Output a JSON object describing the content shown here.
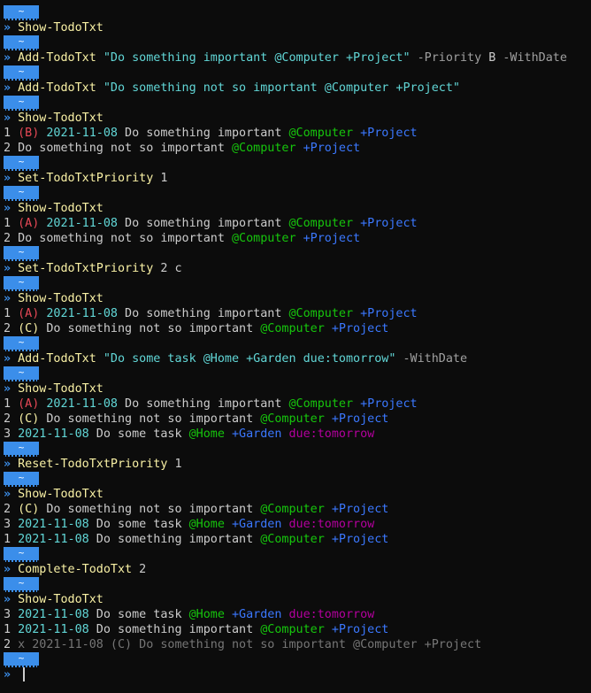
{
  "terminal": {
    "prompt_badge": "~",
    "prompt_arrow": "»",
    "lines": [
      {
        "type": "badge"
      },
      {
        "type": "cmd",
        "segments": [
          {
            "text": "Show-TodoTxt",
            "color": "#f9f1a5"
          }
        ]
      },
      {
        "type": "badge"
      },
      {
        "type": "cmd",
        "segments": [
          {
            "text": "Add-TodoTxt",
            "color": "#f9f1a5"
          },
          {
            "text": " \"Do something important @Computer +Project\"",
            "color": "#61d6d6"
          },
          {
            "text": " -Priority",
            "color": "#a0a0a0"
          },
          {
            "text": " B",
            "color": "#cccccc"
          },
          {
            "text": " -WithDate",
            "color": "#a0a0a0"
          }
        ]
      },
      {
        "type": "badge"
      },
      {
        "type": "cmd",
        "segments": [
          {
            "text": "Add-TodoTxt",
            "color": "#f9f1a5"
          },
          {
            "text": " \"Do something not so important @Computer +Project\"",
            "color": "#61d6d6"
          }
        ]
      },
      {
        "type": "badge"
      },
      {
        "type": "cmd",
        "segments": [
          {
            "text": "Show-TodoTxt",
            "color": "#f9f1a5"
          }
        ]
      },
      {
        "type": "out",
        "segments": [
          {
            "text": "1 ",
            "color": "#cccccc"
          },
          {
            "text": "(B)",
            "color": "#e74856"
          },
          {
            "text": " ",
            "color": "#cccccc"
          },
          {
            "text": "2021-11-08",
            "color": "#61d6d6"
          },
          {
            "text": " Do something important ",
            "color": "#cccccc"
          },
          {
            "text": "@Computer",
            "color": "#16c60c"
          },
          {
            "text": " ",
            "color": "#cccccc"
          },
          {
            "text": "+Project",
            "color": "#3b78ff"
          }
        ]
      },
      {
        "type": "out",
        "segments": [
          {
            "text": "2 Do something not so important ",
            "color": "#cccccc"
          },
          {
            "text": "@Computer",
            "color": "#16c60c"
          },
          {
            "text": " ",
            "color": "#cccccc"
          },
          {
            "text": "+Project",
            "color": "#3b78ff"
          }
        ]
      },
      {
        "type": "badge"
      },
      {
        "type": "cmd",
        "segments": [
          {
            "text": "Set-TodoTxtPriority",
            "color": "#f9f1a5"
          },
          {
            "text": " 1",
            "color": "#cccccc"
          }
        ]
      },
      {
        "type": "badge"
      },
      {
        "type": "cmd",
        "segments": [
          {
            "text": "Show-TodoTxt",
            "color": "#f9f1a5"
          }
        ]
      },
      {
        "type": "out",
        "segments": [
          {
            "text": "1 ",
            "color": "#cccccc"
          },
          {
            "text": "(A)",
            "color": "#e74856"
          },
          {
            "text": " ",
            "color": "#cccccc"
          },
          {
            "text": "2021-11-08",
            "color": "#61d6d6"
          },
          {
            "text": " Do something important ",
            "color": "#cccccc"
          },
          {
            "text": "@Computer",
            "color": "#16c60c"
          },
          {
            "text": " ",
            "color": "#cccccc"
          },
          {
            "text": "+Project",
            "color": "#3b78ff"
          }
        ]
      },
      {
        "type": "out",
        "segments": [
          {
            "text": "2 Do something not so important ",
            "color": "#cccccc"
          },
          {
            "text": "@Computer",
            "color": "#16c60c"
          },
          {
            "text": " ",
            "color": "#cccccc"
          },
          {
            "text": "+Project",
            "color": "#3b78ff"
          }
        ]
      },
      {
        "type": "badge"
      },
      {
        "type": "cmd",
        "segments": [
          {
            "text": "Set-TodoTxtPriority",
            "color": "#f9f1a5"
          },
          {
            "text": " 2 c",
            "color": "#cccccc"
          }
        ]
      },
      {
        "type": "badge"
      },
      {
        "type": "cmd",
        "segments": [
          {
            "text": "Show-TodoTxt",
            "color": "#f9f1a5"
          }
        ]
      },
      {
        "type": "out",
        "segments": [
          {
            "text": "1 ",
            "color": "#cccccc"
          },
          {
            "text": "(A)",
            "color": "#e74856"
          },
          {
            "text": " ",
            "color": "#cccccc"
          },
          {
            "text": "2021-11-08",
            "color": "#61d6d6"
          },
          {
            "text": " Do something important ",
            "color": "#cccccc"
          },
          {
            "text": "@Computer",
            "color": "#16c60c"
          },
          {
            "text": " ",
            "color": "#cccccc"
          },
          {
            "text": "+Project",
            "color": "#3b78ff"
          }
        ]
      },
      {
        "type": "out",
        "segments": [
          {
            "text": "2 ",
            "color": "#cccccc"
          },
          {
            "text": "(C)",
            "color": "#f9f1a5"
          },
          {
            "text": " Do something not so important ",
            "color": "#cccccc"
          },
          {
            "text": "@Computer",
            "color": "#16c60c"
          },
          {
            "text": " ",
            "color": "#cccccc"
          },
          {
            "text": "+Project",
            "color": "#3b78ff"
          }
        ]
      },
      {
        "type": "badge"
      },
      {
        "type": "cmd",
        "segments": [
          {
            "text": "Add-TodoTxt",
            "color": "#f9f1a5"
          },
          {
            "text": " \"Do some task @Home +Garden due:tomorrow\"",
            "color": "#61d6d6"
          },
          {
            "text": " -WithDate",
            "color": "#a0a0a0"
          }
        ]
      },
      {
        "type": "badge"
      },
      {
        "type": "cmd",
        "segments": [
          {
            "text": "Show-TodoTxt",
            "color": "#f9f1a5"
          }
        ]
      },
      {
        "type": "out",
        "segments": [
          {
            "text": "1 ",
            "color": "#cccccc"
          },
          {
            "text": "(A)",
            "color": "#e74856"
          },
          {
            "text": " ",
            "color": "#cccccc"
          },
          {
            "text": "2021-11-08",
            "color": "#61d6d6"
          },
          {
            "text": " Do something important ",
            "color": "#cccccc"
          },
          {
            "text": "@Computer",
            "color": "#16c60c"
          },
          {
            "text": " ",
            "color": "#cccccc"
          },
          {
            "text": "+Project",
            "color": "#3b78ff"
          }
        ]
      },
      {
        "type": "out",
        "segments": [
          {
            "text": "2 ",
            "color": "#cccccc"
          },
          {
            "text": "(C)",
            "color": "#f9f1a5"
          },
          {
            "text": " Do something not so important ",
            "color": "#cccccc"
          },
          {
            "text": "@Computer",
            "color": "#16c60c"
          },
          {
            "text": " ",
            "color": "#cccccc"
          },
          {
            "text": "+Project",
            "color": "#3b78ff"
          }
        ]
      },
      {
        "type": "out",
        "segments": [
          {
            "text": "3 ",
            "color": "#cccccc"
          },
          {
            "text": "2021-11-08",
            "color": "#61d6d6"
          },
          {
            "text": " Do some task ",
            "color": "#cccccc"
          },
          {
            "text": "@Home",
            "color": "#16c60c"
          },
          {
            "text": " ",
            "color": "#cccccc"
          },
          {
            "text": "+Garden",
            "color": "#3b78ff"
          },
          {
            "text": " ",
            "color": "#cccccc"
          },
          {
            "text": "due:tomorrow",
            "color": "#b4009e"
          }
        ]
      },
      {
        "type": "badge"
      },
      {
        "type": "cmd",
        "segments": [
          {
            "text": "Reset-TodoTxtPriority",
            "color": "#f9f1a5"
          },
          {
            "text": " 1",
            "color": "#cccccc"
          }
        ]
      },
      {
        "type": "badge"
      },
      {
        "type": "cmd",
        "segments": [
          {
            "text": "Show-TodoTxt",
            "color": "#f9f1a5"
          }
        ]
      },
      {
        "type": "out",
        "segments": [
          {
            "text": "2 ",
            "color": "#cccccc"
          },
          {
            "text": "(C)",
            "color": "#f9f1a5"
          },
          {
            "text": " Do something not so important ",
            "color": "#cccccc"
          },
          {
            "text": "@Computer",
            "color": "#16c60c"
          },
          {
            "text": " ",
            "color": "#cccccc"
          },
          {
            "text": "+Project",
            "color": "#3b78ff"
          }
        ]
      },
      {
        "type": "out",
        "segments": [
          {
            "text": "3 ",
            "color": "#cccccc"
          },
          {
            "text": "2021-11-08",
            "color": "#61d6d6"
          },
          {
            "text": " Do some task ",
            "color": "#cccccc"
          },
          {
            "text": "@Home",
            "color": "#16c60c"
          },
          {
            "text": " ",
            "color": "#cccccc"
          },
          {
            "text": "+Garden",
            "color": "#3b78ff"
          },
          {
            "text": " ",
            "color": "#cccccc"
          },
          {
            "text": "due:tomorrow",
            "color": "#b4009e"
          }
        ]
      },
      {
        "type": "out",
        "segments": [
          {
            "text": "1 ",
            "color": "#cccccc"
          },
          {
            "text": "2021-11-08",
            "color": "#61d6d6"
          },
          {
            "text": " Do something important ",
            "color": "#cccccc"
          },
          {
            "text": "@Computer",
            "color": "#16c60c"
          },
          {
            "text": " ",
            "color": "#cccccc"
          },
          {
            "text": "+Project",
            "color": "#3b78ff"
          }
        ]
      },
      {
        "type": "badge"
      },
      {
        "type": "cmd",
        "segments": [
          {
            "text": "Complete-TodoTxt",
            "color": "#f9f1a5"
          },
          {
            "text": " 2",
            "color": "#cccccc"
          }
        ]
      },
      {
        "type": "badge"
      },
      {
        "type": "cmd",
        "segments": [
          {
            "text": "Show-TodoTxt",
            "color": "#f9f1a5"
          }
        ]
      },
      {
        "type": "out",
        "segments": [
          {
            "text": "3 ",
            "color": "#cccccc"
          },
          {
            "text": "2021-11-08",
            "color": "#61d6d6"
          },
          {
            "text": " Do some task ",
            "color": "#cccccc"
          },
          {
            "text": "@Home",
            "color": "#16c60c"
          },
          {
            "text": " ",
            "color": "#cccccc"
          },
          {
            "text": "+Garden",
            "color": "#3b78ff"
          },
          {
            "text": " ",
            "color": "#cccccc"
          },
          {
            "text": "due:tomorrow",
            "color": "#b4009e"
          }
        ]
      },
      {
        "type": "out",
        "segments": [
          {
            "text": "1 ",
            "color": "#cccccc"
          },
          {
            "text": "2021-11-08",
            "color": "#61d6d6"
          },
          {
            "text": " Do something important ",
            "color": "#cccccc"
          },
          {
            "text": "@Computer",
            "color": "#16c60c"
          },
          {
            "text": " ",
            "color": "#cccccc"
          },
          {
            "text": "+Project",
            "color": "#3b78ff"
          }
        ]
      },
      {
        "type": "out",
        "segments": [
          {
            "text": "2 ",
            "color": "#cccccc"
          },
          {
            "text": "x 2021-11-08 (C) Do something not so important @Computer +Project",
            "color": "#767676"
          }
        ]
      },
      {
        "type": "badge"
      },
      {
        "type": "input"
      }
    ]
  }
}
